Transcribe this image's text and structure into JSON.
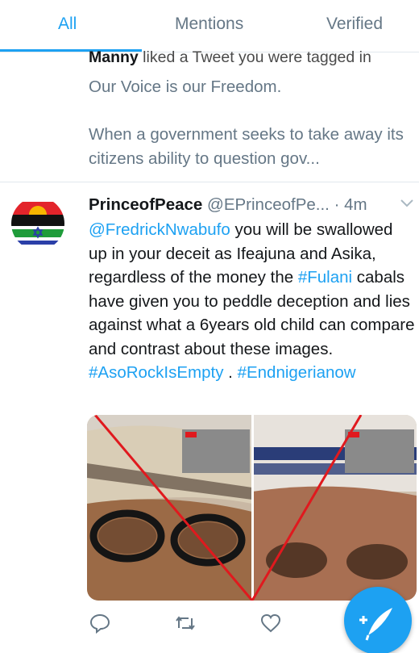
{
  "tabs": [
    {
      "label": "All",
      "active": true
    },
    {
      "label": "Mentions",
      "active": false
    },
    {
      "label": "Verified",
      "active": false
    }
  ],
  "notification": {
    "actor": "Manny",
    "action": " liked a Tweet you were tagged in",
    "tweet_line1": "Our Voice is our Freedom.",
    "tweet_line2": "When a government seeks to take away its citizens ability to question gov..."
  },
  "tweet": {
    "display_name": "PrinceofPeace",
    "handle": "@EPrinceofPe...",
    "timestamp": "· 4m",
    "mention": "@FredrickNwabufo",
    "text_part1": " you will be swallowed up in your deceit as Ifeajuna and Asika, regardless of the money the ",
    "hashtag_fulani": "#Fulani",
    "text_part2": " cabals have given you to peddle deception and lies against what a 6years old child can compare and contrast about these images. ",
    "hashtag_asorock": "#AsoRockIsEmpty",
    "text_part3": " . ",
    "hashtag_end": "#Endnigerianow"
  },
  "icons": {
    "reply": "reply-icon",
    "retweet": "retweet-icon",
    "like": "heart-icon",
    "compose": "compose-tweet-icon",
    "caret": "chevron-down-icon"
  },
  "colors": {
    "accent": "#1da1f2",
    "secondary_text": "#657786",
    "primary_text": "#14171a",
    "divider": "#e1e8ed",
    "annotation_cross": "#e0191e"
  }
}
